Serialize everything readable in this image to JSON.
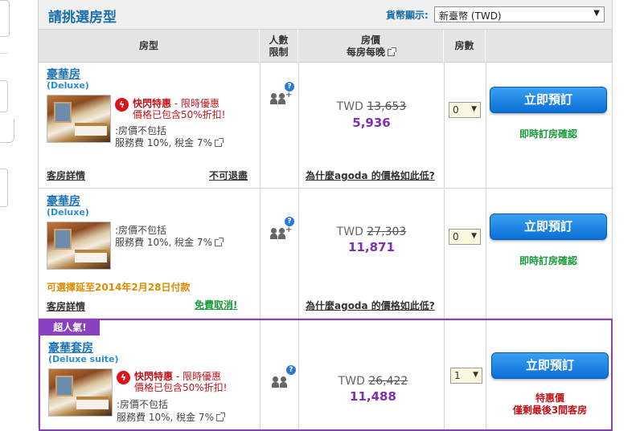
{
  "header": {
    "title": "請挑選房型",
    "currency_label": "貨幣顯示:",
    "currency_selected": "新臺幣 (TWD)"
  },
  "columns": {
    "room_type": "房型",
    "occupancy_l1": "人數",
    "occupancy_l2": "限制",
    "price_l1": "房價",
    "price_l2": "每房每晚",
    "rooms": "房數"
  },
  "rooms": [
    {
      "name": "豪華房",
      "name_en": "(Deluxe)",
      "flash_title": "快閃特惠",
      "flash_sub": " - 限時優惠",
      "flash_line2": "價格已包含50%折扣!",
      "tax_line1": ":房價不包括",
      "tax_line2": "服務費 10%, 稅金 7%",
      "details_link": "客房詳情",
      "policy_link": "不可退盡",
      "currency": "TWD",
      "old_price": "13,653",
      "new_price": "5,936",
      "why_link": "為什麼agoda 的價格如此低?",
      "qty": "0",
      "book_label": "立即預訂",
      "status": "即時訂房確認"
    },
    {
      "name": "豪華房",
      "name_en": "(Deluxe)",
      "tax_line1": ":房價不包括",
      "tax_line2": "服務費 10%, 稅金 7%",
      "pay_later": "可選擇延至2014年2月28日付款",
      "details_link": "客房詳情",
      "policy_link": "免費取消!",
      "currency": "TWD",
      "old_price": "27,303",
      "new_price": "11,871",
      "why_link": "為什麼agoda 的價格如此低?",
      "qty": "0",
      "book_label": "立即預訂",
      "status": "即時訂房確認"
    },
    {
      "badge": "超人氣!",
      "name": "豪華套房",
      "name_en": "(Deluxe suite)",
      "flash_title": "快閃特惠",
      "flash_sub": " - 限時優惠",
      "flash_line2": "價格已包含50%折扣!",
      "tax_line1": ":房價不包括",
      "tax_line2": "服務費 10%, 稅金 7%",
      "currency": "TWD",
      "old_price": "26,422",
      "new_price": "11,488",
      "qty": "1",
      "book_label": "立即預訂",
      "deal_line1": "特惠價",
      "deal_line2": "僅剩最後3間客房"
    }
  ],
  "colors": {
    "title_blue": "#1a6fa8",
    "price_purple": "#7e2fb3",
    "confirm_green": "#1a9b3a",
    "flash_red": "#c0131a",
    "featured_border": "#8b3fc1"
  }
}
